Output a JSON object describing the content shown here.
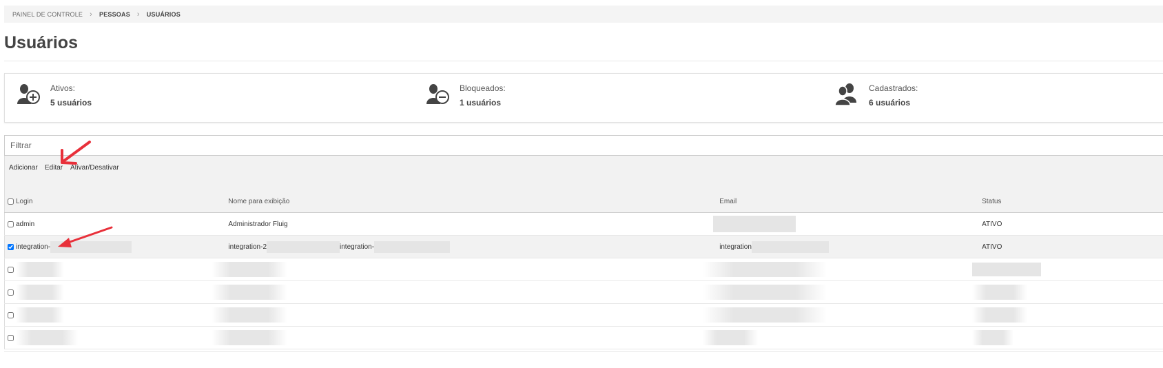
{
  "breadcrumb": {
    "items": [
      "PAINEL DE CONTROLE",
      "PESSOAS",
      "USUÁRIOS"
    ]
  },
  "page": {
    "title": "Usuários"
  },
  "stats": [
    {
      "icon": "user-plus-icon",
      "label": "Ativos:",
      "value": "5 usuários"
    },
    {
      "icon": "user-minus-icon",
      "label": "Bloqueados:",
      "value": "1 usuários"
    },
    {
      "icon": "users-icon",
      "label": "Cadastrados:",
      "value": "6 usuários"
    }
  ],
  "filter": {
    "placeholder": "Filtrar",
    "value": ""
  },
  "toolbar": {
    "add_label": "Adicionar",
    "edit_label": "Editar",
    "toggle_label": "Ativar/Desativar"
  },
  "table": {
    "columns": [
      "Login",
      "Nome para exibição",
      "Email",
      "Status"
    ],
    "rows": [
      {
        "login": "admin",
        "name": "Administrador Fluig",
        "name_suffix": "",
        "email": "",
        "status": "ATIVO",
        "checked": false
      },
      {
        "login": "integration-",
        "name": "integration-2",
        "name_suffix": "integration-",
        "email": "integration",
        "status": "ATIVO",
        "checked": true
      },
      {
        "login": "",
        "name": "",
        "name_suffix": "",
        "email": "",
        "status": "",
        "checked": false
      },
      {
        "login": "",
        "name": "",
        "name_suffix": "",
        "email": "",
        "status": "",
        "checked": false
      },
      {
        "login": "",
        "name": "",
        "name_suffix": "",
        "email": "",
        "status": "",
        "checked": false
      },
      {
        "login": "",
        "name": "",
        "name_suffix": "",
        "email": "",
        "status": "",
        "checked": false
      }
    ]
  },
  "colors": {
    "annotation_arrow": "#e8303a",
    "toolbar_bg": "#f2f2f2",
    "breadcrumb_bg": "#f4f4f4"
  }
}
